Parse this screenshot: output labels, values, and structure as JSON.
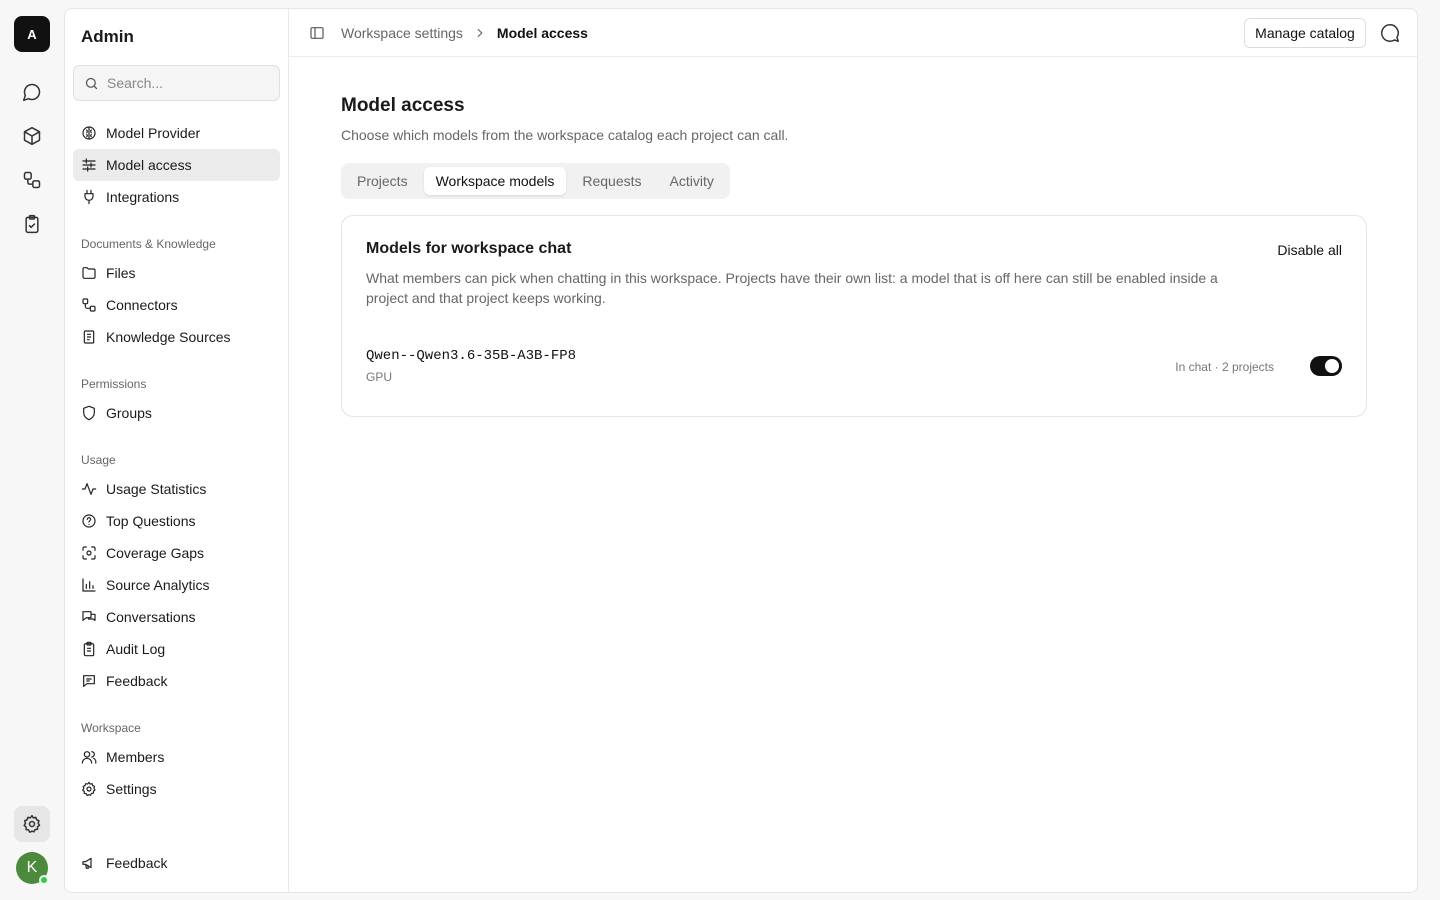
{
  "rail": {
    "logo": "A",
    "avatar": "K",
    "items": [
      {
        "icon": "chat-bubble-icon"
      },
      {
        "icon": "cube-icon"
      },
      {
        "icon": "workflow-icon"
      },
      {
        "icon": "clipboard-check-icon"
      }
    ],
    "settings_icon": "gear-icon"
  },
  "sidebar": {
    "title": "Admin",
    "search_placeholder": "Search...",
    "top_items": [
      {
        "label": "Model Provider",
        "icon": "brain-icon"
      },
      {
        "label": "Model access",
        "icon": "sliders-icon",
        "active": true
      },
      {
        "label": "Integrations",
        "icon": "plug-icon"
      }
    ],
    "sections": [
      {
        "title": "Documents & Knowledge",
        "items": [
          {
            "label": "Files",
            "icon": "folder-icon"
          },
          {
            "label": "Connectors",
            "icon": "connectors-icon"
          },
          {
            "label": "Knowledge Sources",
            "icon": "book-icon"
          }
        ]
      },
      {
        "title": "Permissions",
        "items": [
          {
            "label": "Groups",
            "icon": "shield-icon"
          }
        ]
      },
      {
        "title": "Usage",
        "items": [
          {
            "label": "Usage Statistics",
            "icon": "activity-icon"
          },
          {
            "label": "Top Questions",
            "icon": "question-icon"
          },
          {
            "label": "Coverage Gaps",
            "icon": "scan-icon"
          },
          {
            "label": "Source Analytics",
            "icon": "bar-chart-icon"
          },
          {
            "label": "Conversations",
            "icon": "conversations-icon"
          },
          {
            "label": "Audit Log",
            "icon": "audit-icon"
          },
          {
            "label": "Feedback",
            "icon": "feedback-icon"
          }
        ]
      },
      {
        "title": "Workspace",
        "items": [
          {
            "label": "Members",
            "icon": "users-icon"
          },
          {
            "label": "Settings",
            "icon": "gear-icon"
          }
        ]
      }
    ],
    "footer_item": {
      "label": "Feedback",
      "icon": "megaphone-icon"
    }
  },
  "topbar": {
    "breadcrumb_parent": "Workspace settings",
    "breadcrumb_current": "Model access",
    "manage_catalog": "Manage catalog"
  },
  "page": {
    "title": "Model access",
    "subtitle": "Choose which models from the workspace catalog each project can call.",
    "tabs": [
      {
        "label": "Projects"
      },
      {
        "label": "Workspace models",
        "active": true
      },
      {
        "label": "Requests"
      },
      {
        "label": "Activity"
      }
    ]
  },
  "card": {
    "title": "Models for workspace chat",
    "description": "What members can pick when chatting in this workspace. Projects have their own list: a model that is off here can still be enabled inside a project and that project keeps working.",
    "disable_all": "Disable all",
    "models": [
      {
        "name": "Qwen--Qwen3.6-35B-A3B-FP8",
        "tag": "GPU",
        "status": "In chat · 2 projects",
        "enabled": true
      }
    ]
  },
  "colors": {
    "accent": "#111111",
    "avatar_bg": "#4b8a3c",
    "online_dot": "#2ecc40"
  }
}
